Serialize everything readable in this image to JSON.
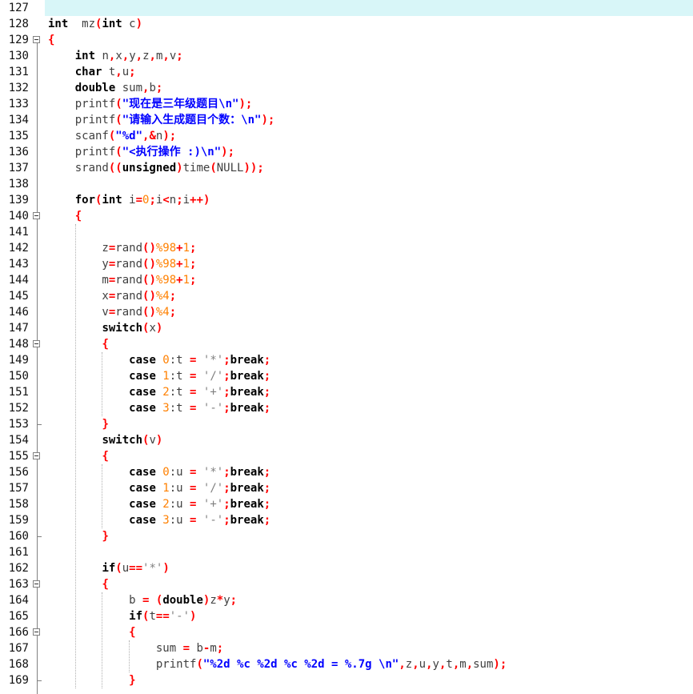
{
  "editor": {
    "colors": {
      "background": "#ffffff",
      "current_line": "#d8f6f8",
      "keyword": "#000000",
      "operator": "#ff0000",
      "number": "#ff8000",
      "string": "#0000ff",
      "char": "#808080"
    },
    "lines": [
      {
        "n": "127",
        "segs": [],
        "active": true
      },
      {
        "n": "128",
        "segs": [
          [
            "kw",
            "int"
          ],
          [
            "",
            "  mz"
          ],
          [
            "op",
            "("
          ],
          [
            "kw",
            "int"
          ],
          [
            "",
            " c"
          ],
          [
            "op",
            ")"
          ]
        ]
      },
      {
        "n": "129",
        "fold": "open",
        "segs": [
          [
            "op",
            "{"
          ]
        ]
      },
      {
        "n": "130",
        "segs": [
          [
            "",
            "    "
          ],
          [
            "kw",
            "int"
          ],
          [
            "",
            " n"
          ],
          [
            "op",
            ","
          ],
          [
            "",
            "x"
          ],
          [
            "op",
            ","
          ],
          [
            "",
            "y"
          ],
          [
            "op",
            ","
          ],
          [
            "",
            "z"
          ],
          [
            "op",
            ","
          ],
          [
            "",
            "m"
          ],
          [
            "op",
            ","
          ],
          [
            "",
            "v"
          ],
          [
            "op",
            ";"
          ]
        ]
      },
      {
        "n": "131",
        "segs": [
          [
            "",
            "    "
          ],
          [
            "kw",
            "char"
          ],
          [
            "",
            " t"
          ],
          [
            "op",
            ","
          ],
          [
            "",
            "u"
          ],
          [
            "op",
            ";"
          ]
        ]
      },
      {
        "n": "132",
        "segs": [
          [
            "",
            "    "
          ],
          [
            "kw",
            "double"
          ],
          [
            "",
            " sum"
          ],
          [
            "op",
            ","
          ],
          [
            "",
            "b"
          ],
          [
            "op",
            ";"
          ]
        ]
      },
      {
        "n": "133",
        "segs": [
          [
            "",
            "    printf"
          ],
          [
            "op",
            "("
          ],
          [
            "str",
            "\"现在是三年级题目\\n\""
          ],
          [
            "op",
            ");"
          ]
        ]
      },
      {
        "n": "134",
        "segs": [
          [
            "",
            "    printf"
          ],
          [
            "op",
            "("
          ],
          [
            "str",
            "\"请输入生成题目个数：\\n\""
          ],
          [
            "op",
            ");"
          ]
        ]
      },
      {
        "n": "135",
        "segs": [
          [
            "",
            "    scanf"
          ],
          [
            "op",
            "("
          ],
          [
            "str",
            "\"%d\""
          ],
          [
            "op",
            ",&"
          ],
          [
            "",
            "n"
          ],
          [
            "op",
            ");"
          ]
        ]
      },
      {
        "n": "136",
        "segs": [
          [
            "",
            "    printf"
          ],
          [
            "op",
            "("
          ],
          [
            "str",
            "\"<执行操作 :)\\n\""
          ],
          [
            "op",
            ");"
          ]
        ]
      },
      {
        "n": "137",
        "segs": [
          [
            "",
            "    srand"
          ],
          [
            "op",
            "(("
          ],
          [
            "kw",
            "unsigned"
          ],
          [
            "op",
            ")"
          ],
          [
            "",
            "time"
          ],
          [
            "op",
            "("
          ],
          [
            "",
            "NULL"
          ],
          [
            "op",
            "));"
          ]
        ]
      },
      {
        "n": "138",
        "segs": []
      },
      {
        "n": "139",
        "segs": [
          [
            "",
            "    "
          ],
          [
            "kw",
            "for"
          ],
          [
            "op",
            "("
          ],
          [
            "kw",
            "int"
          ],
          [
            "",
            " i"
          ],
          [
            "op",
            "="
          ],
          [
            "num",
            "0"
          ],
          [
            "op",
            ";"
          ],
          [
            "",
            "i"
          ],
          [
            "op",
            "<"
          ],
          [
            "",
            "n"
          ],
          [
            "op",
            ";"
          ],
          [
            "",
            "i"
          ],
          [
            "op",
            "++)"
          ]
        ]
      },
      {
        "n": "140",
        "fold": "open",
        "segs": [
          [
            "",
            "    "
          ],
          [
            "op",
            "{"
          ]
        ]
      },
      {
        "n": "141",
        "segs": []
      },
      {
        "n": "142",
        "segs": [
          [
            "",
            "        z"
          ],
          [
            "op",
            "="
          ],
          [
            "",
            "rand"
          ],
          [
            "op",
            "()"
          ],
          [
            "num",
            "%98"
          ],
          [
            "op",
            "+"
          ],
          [
            "num",
            "1"
          ],
          [
            "op",
            ";"
          ]
        ]
      },
      {
        "n": "143",
        "segs": [
          [
            "",
            "        y"
          ],
          [
            "op",
            "="
          ],
          [
            "",
            "rand"
          ],
          [
            "op",
            "()"
          ],
          [
            "num",
            "%98"
          ],
          [
            "op",
            "+"
          ],
          [
            "num",
            "1"
          ],
          [
            "op",
            ";"
          ]
        ]
      },
      {
        "n": "144",
        "segs": [
          [
            "",
            "        m"
          ],
          [
            "op",
            "="
          ],
          [
            "",
            "rand"
          ],
          [
            "op",
            "()"
          ],
          [
            "num",
            "%98"
          ],
          [
            "op",
            "+"
          ],
          [
            "num",
            "1"
          ],
          [
            "op",
            ";"
          ]
        ]
      },
      {
        "n": "145",
        "segs": [
          [
            "",
            "        x"
          ],
          [
            "op",
            "="
          ],
          [
            "",
            "rand"
          ],
          [
            "op",
            "()"
          ],
          [
            "num",
            "%4"
          ],
          [
            "op",
            ";"
          ]
        ]
      },
      {
        "n": "146",
        "segs": [
          [
            "",
            "        v"
          ],
          [
            "op",
            "="
          ],
          [
            "",
            "rand"
          ],
          [
            "op",
            "()"
          ],
          [
            "num",
            "%4"
          ],
          [
            "op",
            ";"
          ]
        ]
      },
      {
        "n": "147",
        "segs": [
          [
            "",
            "        "
          ],
          [
            "kw",
            "switch"
          ],
          [
            "op",
            "("
          ],
          [
            "",
            "x"
          ],
          [
            "op",
            ")"
          ]
        ]
      },
      {
        "n": "148",
        "fold": "open",
        "segs": [
          [
            "",
            "        "
          ],
          [
            "op",
            "{"
          ]
        ]
      },
      {
        "n": "149",
        "segs": [
          [
            "",
            "            "
          ],
          [
            "kw",
            "case"
          ],
          [
            "num",
            " 0"
          ],
          [
            "",
            ":t "
          ],
          [
            "op",
            "="
          ],
          [
            "chr",
            " '*'"
          ],
          [
            "op",
            ";"
          ],
          [
            "kw",
            "break"
          ],
          [
            "op",
            ";"
          ]
        ]
      },
      {
        "n": "150",
        "segs": [
          [
            "",
            "            "
          ],
          [
            "kw",
            "case"
          ],
          [
            "num",
            " 1"
          ],
          [
            "",
            ":t "
          ],
          [
            "op",
            "="
          ],
          [
            "chr",
            " '/'"
          ],
          [
            "op",
            ";"
          ],
          [
            "kw",
            "break"
          ],
          [
            "op",
            ";"
          ]
        ]
      },
      {
        "n": "151",
        "segs": [
          [
            "",
            "            "
          ],
          [
            "kw",
            "case"
          ],
          [
            "num",
            " 2"
          ],
          [
            "",
            ":t "
          ],
          [
            "op",
            "="
          ],
          [
            "chr",
            " '+'"
          ],
          [
            "op",
            ";"
          ],
          [
            "kw",
            "break"
          ],
          [
            "op",
            ";"
          ]
        ]
      },
      {
        "n": "152",
        "segs": [
          [
            "",
            "            "
          ],
          [
            "kw",
            "case"
          ],
          [
            "num",
            " 3"
          ],
          [
            "",
            ":t "
          ],
          [
            "op",
            "="
          ],
          [
            "chr",
            " '-'"
          ],
          [
            "op",
            ";"
          ],
          [
            "kw",
            "break"
          ],
          [
            "op",
            ";"
          ]
        ]
      },
      {
        "n": "153",
        "fold": "end",
        "segs": [
          [
            "",
            "        "
          ],
          [
            "op",
            "}"
          ]
        ]
      },
      {
        "n": "154",
        "segs": [
          [
            "",
            "        "
          ],
          [
            "kw",
            "switch"
          ],
          [
            "op",
            "("
          ],
          [
            "",
            "v"
          ],
          [
            "op",
            ")"
          ]
        ]
      },
      {
        "n": "155",
        "fold": "open",
        "segs": [
          [
            "",
            "        "
          ],
          [
            "op",
            "{"
          ]
        ]
      },
      {
        "n": "156",
        "segs": [
          [
            "",
            "            "
          ],
          [
            "kw",
            "case"
          ],
          [
            "num",
            " 0"
          ],
          [
            "",
            ":u "
          ],
          [
            "op",
            "="
          ],
          [
            "chr",
            " '*'"
          ],
          [
            "op",
            ";"
          ],
          [
            "kw",
            "break"
          ],
          [
            "op",
            ";"
          ]
        ]
      },
      {
        "n": "157",
        "segs": [
          [
            "",
            "            "
          ],
          [
            "kw",
            "case"
          ],
          [
            "num",
            " 1"
          ],
          [
            "",
            ":u "
          ],
          [
            "op",
            "="
          ],
          [
            "chr",
            " '/'"
          ],
          [
            "op",
            ";"
          ],
          [
            "kw",
            "break"
          ],
          [
            "op",
            ";"
          ]
        ]
      },
      {
        "n": "158",
        "segs": [
          [
            "",
            "            "
          ],
          [
            "kw",
            "case"
          ],
          [
            "num",
            " 2"
          ],
          [
            "",
            ":u "
          ],
          [
            "op",
            "="
          ],
          [
            "chr",
            " '+'"
          ],
          [
            "op",
            ";"
          ],
          [
            "kw",
            "break"
          ],
          [
            "op",
            ";"
          ]
        ]
      },
      {
        "n": "159",
        "segs": [
          [
            "",
            "            "
          ],
          [
            "kw",
            "case"
          ],
          [
            "num",
            " 3"
          ],
          [
            "",
            ":u "
          ],
          [
            "op",
            "="
          ],
          [
            "chr",
            " '-'"
          ],
          [
            "op",
            ";"
          ],
          [
            "kw",
            "break"
          ],
          [
            "op",
            ";"
          ]
        ]
      },
      {
        "n": "160",
        "fold": "end",
        "segs": [
          [
            "",
            "        "
          ],
          [
            "op",
            "}"
          ]
        ]
      },
      {
        "n": "161",
        "segs": []
      },
      {
        "n": "162",
        "segs": [
          [
            "",
            "        "
          ],
          [
            "kw",
            "if"
          ],
          [
            "op",
            "("
          ],
          [
            "",
            "u"
          ],
          [
            "op",
            "=="
          ],
          [
            "chr",
            "'*'"
          ],
          [
            "op",
            ")"
          ]
        ]
      },
      {
        "n": "163",
        "fold": "open",
        "segs": [
          [
            "",
            "        "
          ],
          [
            "op",
            "{"
          ]
        ]
      },
      {
        "n": "164",
        "segs": [
          [
            "",
            "            b "
          ],
          [
            "op",
            "="
          ],
          [
            "",
            " "
          ],
          [
            "op",
            "("
          ],
          [
            "kw",
            "double"
          ],
          [
            "op",
            ")"
          ],
          [
            "",
            "z"
          ],
          [
            "op",
            "*"
          ],
          [
            "",
            "y"
          ],
          [
            "op",
            ";"
          ]
        ]
      },
      {
        "n": "165",
        "segs": [
          [
            "",
            "            "
          ],
          [
            "kw",
            "if"
          ],
          [
            "op",
            "("
          ],
          [
            "",
            "t"
          ],
          [
            "op",
            "=="
          ],
          [
            "chr",
            "'-'"
          ],
          [
            "op",
            ")"
          ]
        ]
      },
      {
        "n": "166",
        "fold": "open",
        "segs": [
          [
            "",
            "            "
          ],
          [
            "op",
            "{"
          ]
        ]
      },
      {
        "n": "167",
        "segs": [
          [
            "",
            "                sum "
          ],
          [
            "op",
            "="
          ],
          [
            "",
            " b"
          ],
          [
            "op",
            "-"
          ],
          [
            "",
            "m"
          ],
          [
            "op",
            ";"
          ]
        ]
      },
      {
        "n": "168",
        "segs": [
          [
            "",
            "                printf"
          ],
          [
            "op",
            "("
          ],
          [
            "str",
            "\"%2d %c %2d %c %2d = %.7g \\n\""
          ],
          [
            "op",
            ","
          ],
          [
            "",
            "z"
          ],
          [
            "op",
            ","
          ],
          [
            "",
            "u"
          ],
          [
            "op",
            ","
          ],
          [
            "",
            "y"
          ],
          [
            "op",
            ","
          ],
          [
            "",
            "t"
          ],
          [
            "op",
            ","
          ],
          [
            "",
            "m"
          ],
          [
            "op",
            ","
          ],
          [
            "",
            "sum"
          ],
          [
            "op",
            ");"
          ]
        ]
      },
      {
        "n": "169",
        "fold": "end",
        "segs": [
          [
            "",
            "            "
          ],
          [
            "op",
            "}"
          ]
        ]
      }
    ]
  }
}
